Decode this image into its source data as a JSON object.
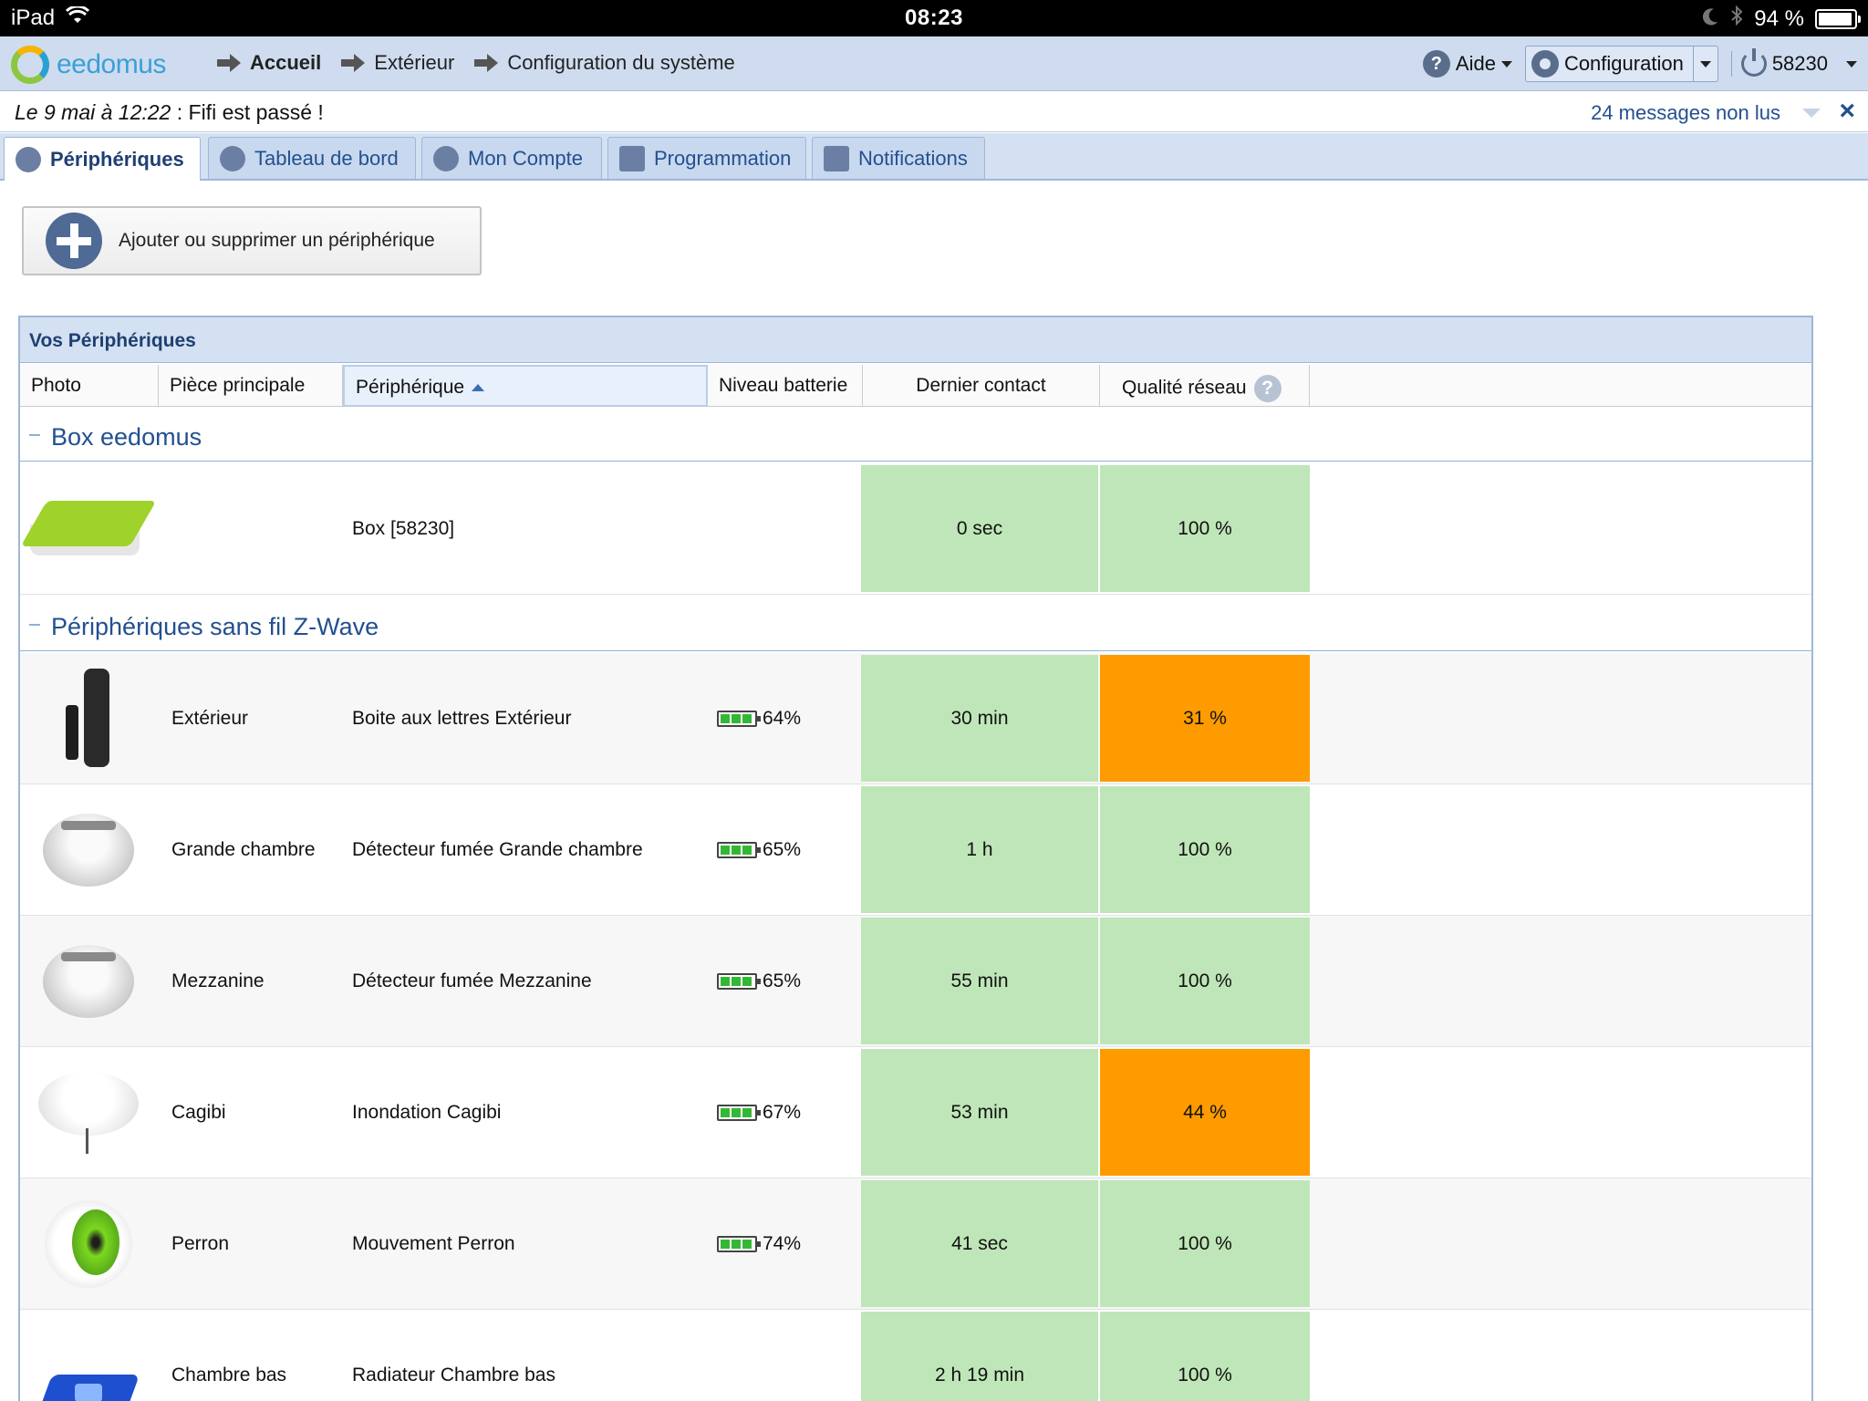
{
  "status_bar": {
    "device": "iPad",
    "time": "08:23",
    "battery_pct": "94 %"
  },
  "header": {
    "logo_text": "eedomus",
    "breadcrumbs": [
      "Accueil",
      "Extérieur",
      "Configuration du système"
    ],
    "help_label": "Aide",
    "config_label": "Configuration",
    "account_id": "58230"
  },
  "message_bar": {
    "date": "Le 9 mai à 12:22",
    "text": " : Fifi est passé !",
    "unread": "24 messages non lus",
    "close_glyph": "×"
  },
  "tabs": [
    {
      "label": "Périphériques",
      "icon": "devices-icon",
      "active": true
    },
    {
      "label": "Tableau de bord",
      "icon": "dashboard-icon"
    },
    {
      "label": "Mon Compte",
      "icon": "user-icon"
    },
    {
      "label": "Programmation",
      "icon": "wand-icon"
    },
    {
      "label": "Notifications",
      "icon": "mail-icon"
    }
  ],
  "add_button_label": "Ajouter ou supprimer un périphérique",
  "panel": {
    "title": "Vos Périphériques",
    "columns": [
      "Photo",
      "Pièce principale",
      "Périphérique",
      "Niveau batterie",
      "Dernier contact",
      "Qualité réseau"
    ],
    "groups": [
      {
        "name": "Box eedomus"
      },
      {
        "name": "Périphériques sans fil Z-Wave"
      }
    ],
    "box_row": {
      "photo": "eedomus-box-image",
      "room": "",
      "device": "Box [58230]",
      "battery": "",
      "contact": "0 sec",
      "quality": "100 %"
    },
    "zwave_rows": [
      {
        "photo": "door-sensor-image",
        "room": "Extérieur",
        "device": "Boite aux lettres Extérieur",
        "battery": "64%",
        "contact": "30 min",
        "quality": "31 %",
        "quality_status": "warn"
      },
      {
        "photo": "smoke-detector-image",
        "room": "Grande chambre",
        "device": "Détecteur fumée Grande chambre",
        "battery": "65%",
        "contact": "1 h",
        "quality": "100 %",
        "quality_status": "ok"
      },
      {
        "photo": "smoke-detector-image",
        "room": "Mezzanine",
        "device": "Détecteur fumée Mezzanine",
        "battery": "65%",
        "contact": "55 min",
        "quality": "100 %",
        "quality_status": "ok"
      },
      {
        "photo": "flood-sensor-image",
        "room": "Cagibi",
        "device": "Inondation Cagibi",
        "battery": "67%",
        "contact": "53 min",
        "quality": "44 %",
        "quality_status": "warn"
      },
      {
        "photo": "motion-sensor-image",
        "room": "Perron",
        "device": "Mouvement Perron",
        "battery": "74%",
        "contact": "41 sec",
        "quality": "100 %",
        "quality_status": "ok"
      },
      {
        "photo": "heater-module-image",
        "room": "Chambre bas",
        "device": "Radiateur Chambre bas",
        "battery": "",
        "contact": "2 h 19 min",
        "quality": "100 %",
        "quality_status": "ok"
      }
    ]
  },
  "colors": {
    "ok": "#bfe6b8",
    "warn": "#fd9b00",
    "header_bg": "#cfdcef",
    "link": "#23508f"
  }
}
